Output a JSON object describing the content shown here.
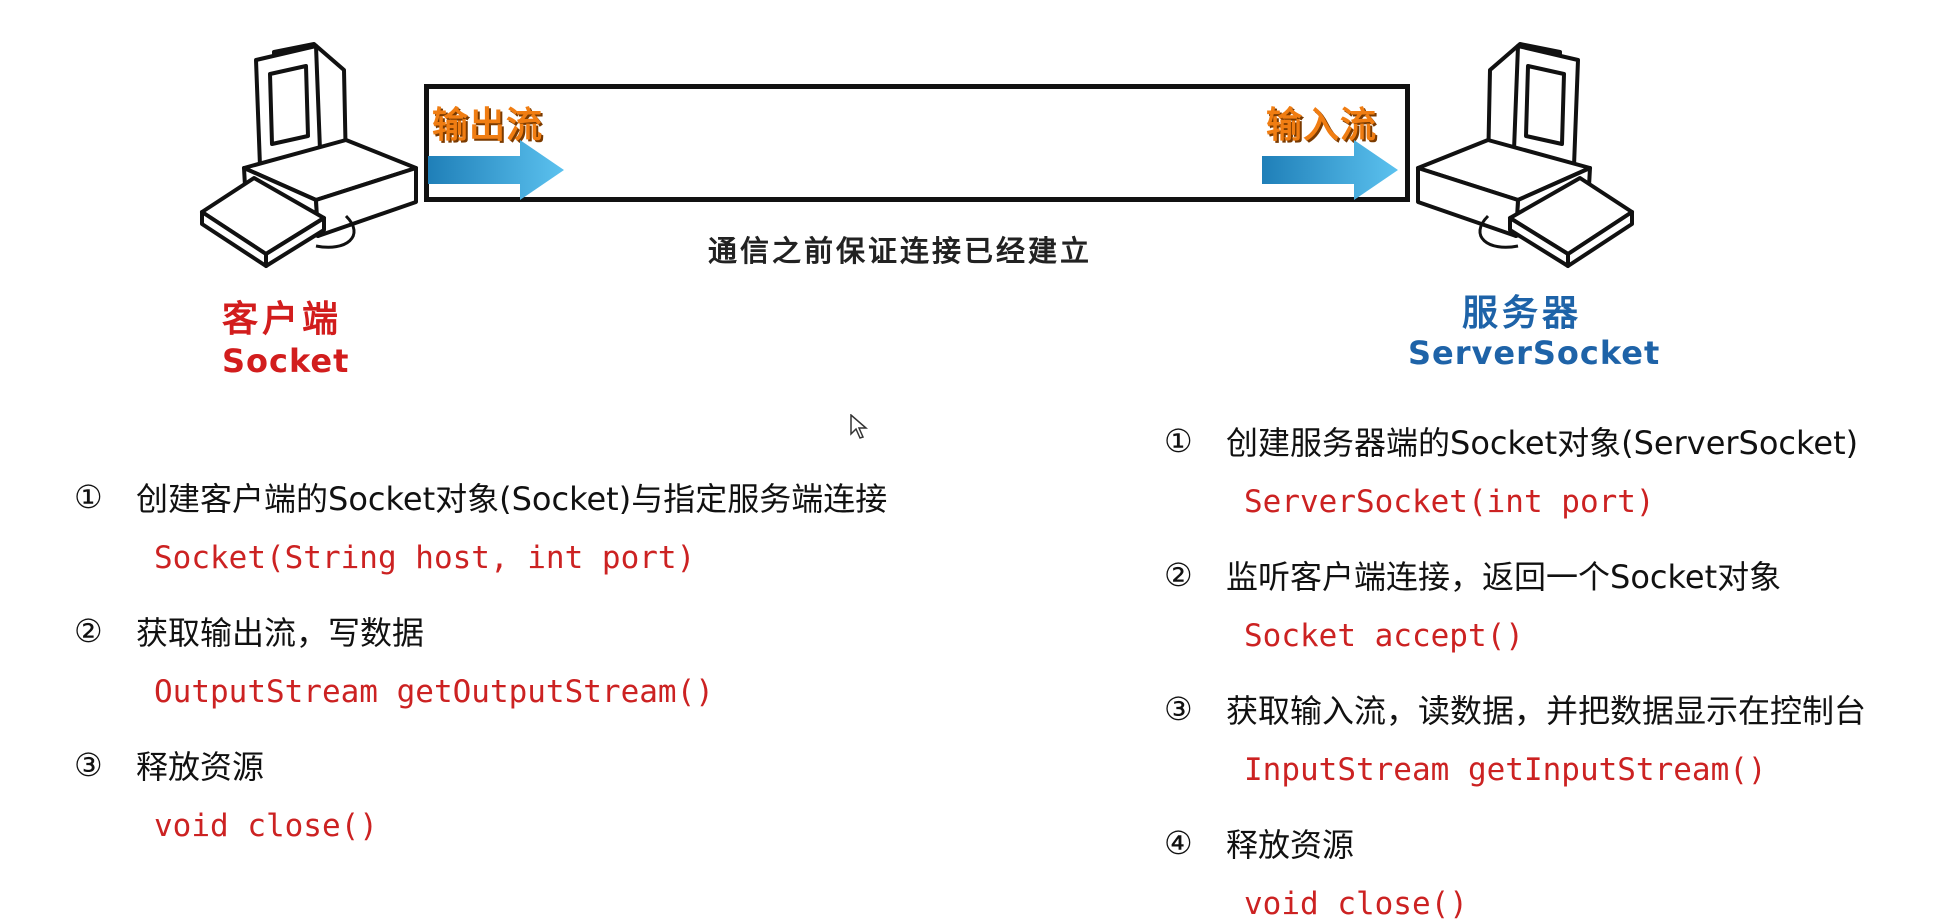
{
  "diagram": {
    "output_stream_label": "输出流",
    "input_stream_label": "输入流",
    "connection_caption": "通信之前保证连接已经建立",
    "client": {
      "title": "客户端",
      "subtitle": "Socket"
    },
    "server": {
      "title": "服务器",
      "subtitle": "ServerSocket"
    }
  },
  "client_steps": [
    {
      "num": "①",
      "text": "创建客户端的Socket对象(Socket)与指定服务端连接",
      "code": "Socket(String host, int port)"
    },
    {
      "num": "②",
      "text": "获取输出流，写数据",
      "code": "OutputStream getOutputStream()"
    },
    {
      "num": "③",
      "text": "释放资源",
      "code": "void close()"
    }
  ],
  "server_steps": [
    {
      "num": "①",
      "text": "创建服务器端的Socket对象(ServerSocket)",
      "code": "ServerSocket(int port)"
    },
    {
      "num": "②",
      "text": "监听客户端连接，返回一个Socket对象",
      "code": "Socket accept()"
    },
    {
      "num": "③",
      "text": "获取输入流，读数据，并把数据显示在控制台",
      "code": "InputStream getInputStream()"
    },
    {
      "num": "④",
      "text": "释放资源",
      "code": "void close()"
    }
  ],
  "colors": {
    "flow_label": "#f07d12",
    "arrow": "#3aa6dc",
    "client_title": "#d21d1d",
    "server_title": "#1e63a8",
    "code": "#cc2222"
  }
}
